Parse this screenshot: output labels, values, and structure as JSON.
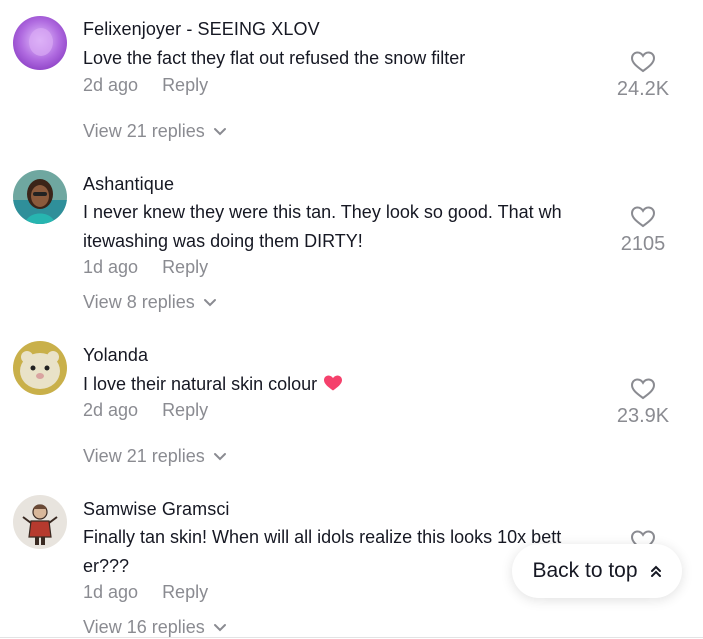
{
  "comments": [
    {
      "username": "Felixenjoyer - SEEING XLOV",
      "lines": [
        "Love the fact they flat out refused the snow filter"
      ],
      "time": "2d ago",
      "reply_label": "Reply",
      "likes": "24.2K",
      "replies_label": "View 21 replies",
      "avatar_icon": "purple-blur-avatar"
    },
    {
      "username": "Ashantique",
      "lines": [
        "I never knew they were this tan. They look so good. That wh",
        "itewashing was doing them DIRTY!"
      ],
      "time": "1d ago",
      "reply_label": "Reply",
      "likes": "2105",
      "replies_label": "View 8 replies",
      "avatar_icon": "person-photo-avatar"
    },
    {
      "username": "Yolanda",
      "lines": [
        "I love their natural skin colour"
      ],
      "time": "2d ago",
      "reply_label": "Reply",
      "likes": "23.9K",
      "replies_label": "View 21 replies",
      "avatar_icon": "hamster-avatar",
      "emoji": "pink-heart-icon"
    },
    {
      "username": "Samwise Gramsci",
      "lines": [
        "Finally tan skin! When will all idols realize this looks 10x bett",
        "er???"
      ],
      "time": "1d ago",
      "reply_label": "Reply",
      "likes": "",
      "replies_label": "View 16 replies",
      "avatar_icon": "cartoon-character-avatar"
    }
  ],
  "back_to_top": {
    "label": "Back to top",
    "icon": "double-chevron-up-icon"
  },
  "colors": {
    "text": "#161823",
    "muted": "#8a8b91",
    "heart_emoji": "#f5416c"
  }
}
